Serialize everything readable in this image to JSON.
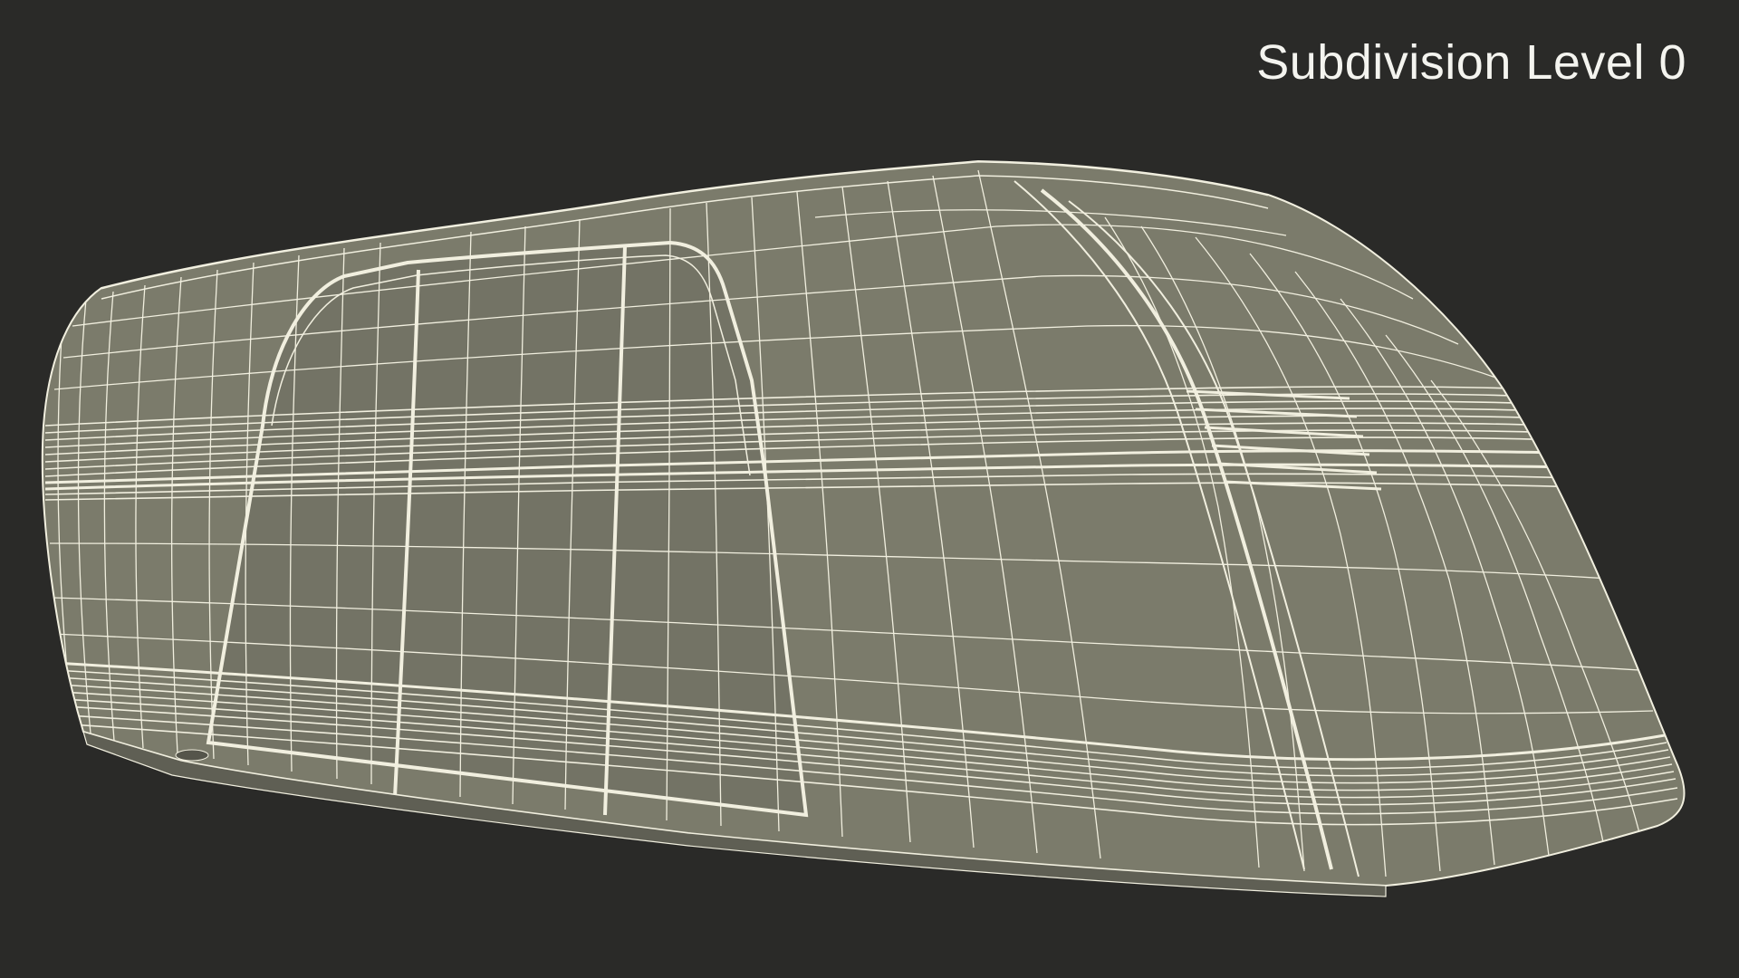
{
  "viewport": {
    "label": "Subdivision Level 0"
  },
  "colors": {
    "background": "#2a2a28",
    "surface": "#7b7b6b",
    "surface_dark": "#6c6c5e",
    "wire": "#f1efdf",
    "label": "#f4f4ef"
  },
  "model": {
    "shading": "flat grey clay",
    "overlay": "white wireframe"
  }
}
